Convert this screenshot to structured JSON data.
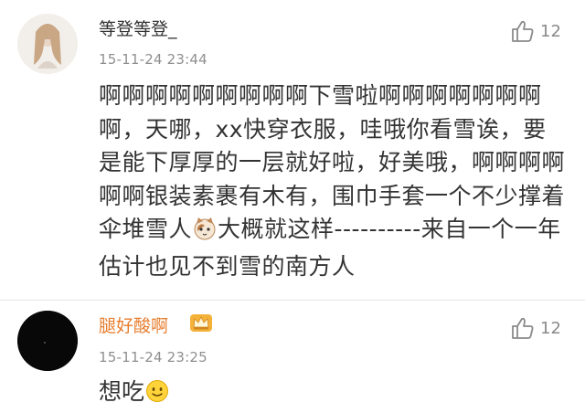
{
  "comments": [
    {
      "author": "等登等登_",
      "time": "15-11-24 23:44",
      "likes": "12",
      "text_part1": "啊啊啊啊啊啊啊啊啊下雪啦啊啊啊啊啊啊啊啊，天哪，xx快穿衣服，哇哦你看雪诶，要是能下厚厚的一层就好啦，好美哦，啊啊啊啊啊啊银装素裹有木有，围巾手套一个不少撑着伞堆雪人",
      "text_part2": "大概就这样----------来自一个一年估计也见不到雪的南方人",
      "inline_emoji": "cat-face-icon"
    },
    {
      "author": "腿好酸啊",
      "time": "15-11-24 23:25",
      "likes": "12",
      "text": "想吃",
      "inline_emoji": "smiley-face-icon",
      "author_color": "#e87e2f",
      "badge": "crown-icon"
    }
  ]
}
